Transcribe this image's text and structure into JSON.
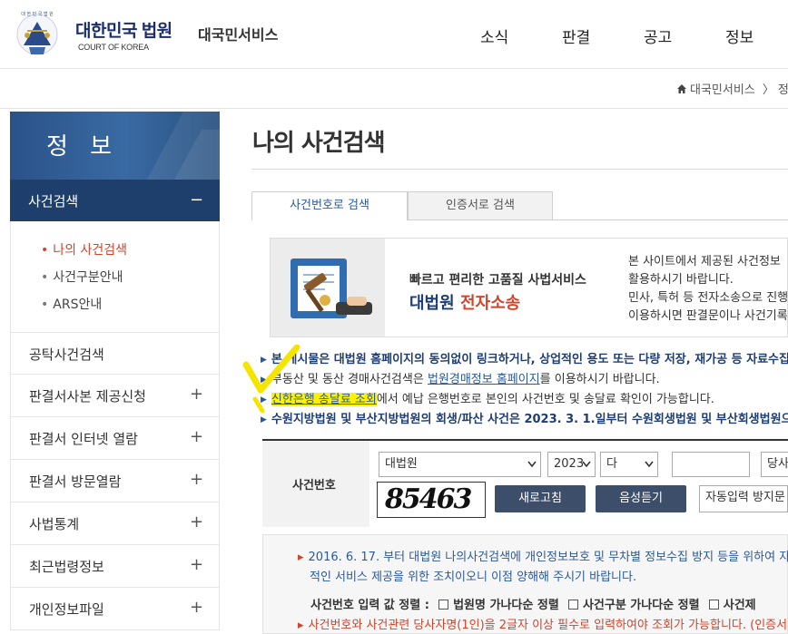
{
  "header": {
    "logo_title": "대한민국 법원",
    "logo_sub": "COURT OF KOREA",
    "site_name": "대국민서비스",
    "nav": [
      "소식",
      "판결",
      "공고",
      "정보"
    ]
  },
  "breadcrumb": {
    "home": "대국민서비스",
    "separator": "〉",
    "next": "정"
  },
  "sidebar": {
    "title": "정 보",
    "active_section": "사건검색",
    "active_toggle": "−",
    "sub_items": [
      "나의 사건검색",
      "사건구분안내",
      "ARS안내"
    ],
    "items": [
      {
        "label": "공탁사건검색",
        "toggle": ""
      },
      {
        "label": "판결서사본 제공신청",
        "toggle": "+"
      },
      {
        "label": "판결서 인터넷 열람",
        "toggle": "+"
      },
      {
        "label": "판결서 방문열람",
        "toggle": "+"
      },
      {
        "label": "사법통계",
        "toggle": "+"
      },
      {
        "label": "최근법령정보",
        "toggle": "+"
      },
      {
        "label": "개인정보파일",
        "toggle": "+"
      }
    ]
  },
  "main": {
    "title": "나의 사건검색",
    "tabs": [
      "사건번호로 검색",
      "인증서로 검색"
    ],
    "banner": {
      "small": "빠르고 편리한 고품질 사법서비스",
      "big_blue": "대법원",
      "big_red": "전자소송",
      "right_lines": [
        "본 사이트에서 제공된 사건정보",
        "활용하시기 바랍니다.",
        "민사, 특허 등 전자소송으로 진행",
        "이용하시면 판결문이나 사건기록"
      ]
    },
    "notices": [
      {
        "text": "본 게시물은 대법원 홈페이지의 동의없이 링크하거나, 상업적인 용도 또는 다량 저장, 재가공 등 자료수집"
      },
      {
        "pre": "부동산 및 동산 경매사건검색은 ",
        "link": "법원경매정보 홈페이지",
        "post": "를 이용하시기 바랍니다."
      },
      {
        "link": "신한은행 송달료 조회",
        "post": "에서 예납 은행번호로 본인의 사건번호 및 송달료 확인이 가능합니다."
      },
      {
        "text": "수원지방법원 및 부산지방법원의 회생/파산 사건은 2023. 3. 1.일부터 수원회생법원 및 부산회생법원으"
      }
    ],
    "search": {
      "label": "사건번호",
      "court": "대법원",
      "year": "2023",
      "case_type": "다",
      "case_number": "",
      "party_placeholder": "당사",
      "captcha": "85463",
      "refresh_label": "새로고침",
      "audio_label": "음성듣기",
      "captcha_input_placeholder": "자동입력 방지문"
    },
    "info": {
      "line1": "2016. 6. 17. 부터 대법원 나의사건검색에 개인정보보호 및 무차별 정보수집 방지 등을 위하여 자",
      "line2": "적인 서비스 제공을 위한 조치이오니 이점 양해해 주시기 바랍니다.",
      "order_label": "사건번호 입력 값 정렬 :",
      "order_options": [
        "법원명 가나다순 정렬",
        "사건구분 가나다순 정렬",
        "사건제"
      ],
      "warning": "사건번호와 사건관련 당사자명(1인)을 2글자 이상 필수로 입력하여야 조회가 가능합니다. (인증서"
    }
  },
  "colors": {
    "navy": "#1e3f6b",
    "accent_red": "#d3432a",
    "highlight": "#fff200"
  }
}
